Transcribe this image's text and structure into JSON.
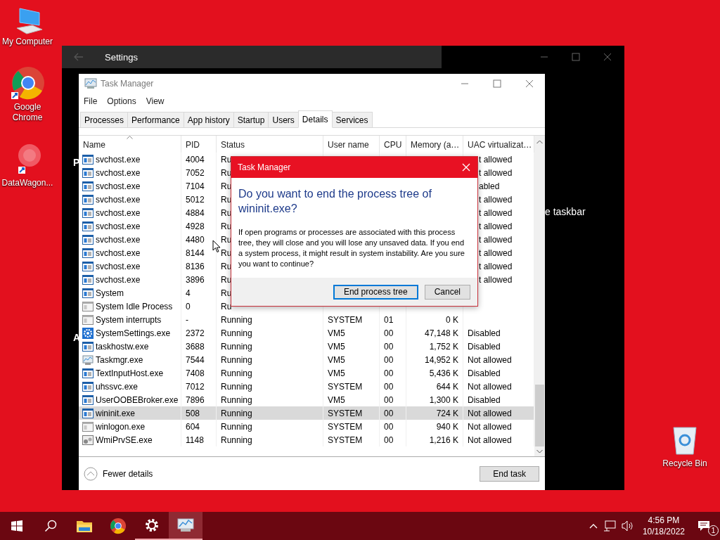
{
  "desktop": {
    "icons": [
      {
        "label": "My Computer",
        "kind": "computer"
      },
      {
        "label": "Google Chrome",
        "kind": "chrome"
      },
      {
        "label": "DataWagon...",
        "kind": "datawagon"
      }
    ],
    "recycle_bin": {
      "label": "Recycle Bin"
    }
  },
  "settings_window": {
    "title": "Settings",
    "side_letters": [
      "P",
      "A"
    ],
    "partial_text": "e taskbar"
  },
  "task_manager": {
    "title": "Task Manager",
    "menu": [
      "File",
      "Options",
      "View"
    ],
    "tabs": [
      {
        "label": "Processes",
        "selected": false
      },
      {
        "label": "Performance",
        "selected": false
      },
      {
        "label": "App history",
        "selected": false
      },
      {
        "label": "Startup",
        "selected": false
      },
      {
        "label": "Users",
        "selected": false
      },
      {
        "label": "Details",
        "selected": true
      },
      {
        "label": "Services",
        "selected": false
      }
    ],
    "columns": [
      {
        "label": "Name",
        "sorted": true
      },
      {
        "label": "PID"
      },
      {
        "label": "Status"
      },
      {
        "label": "User name"
      },
      {
        "label": "CPU"
      },
      {
        "label": "Memory (a…"
      },
      {
        "label": "UAC virtualizat…"
      }
    ],
    "rows": [
      {
        "kind": "app",
        "name": "svchost.exe",
        "pid": "4004",
        "status": "Ru",
        "uac": "t allowed",
        "selected": false
      },
      {
        "kind": "app",
        "name": "svchost.exe",
        "pid": "7052",
        "status": "Ru",
        "uac": "t allowed",
        "selected": false
      },
      {
        "kind": "app",
        "name": "svchost.exe",
        "pid": "7104",
        "status": "Ru",
        "uac": "abled",
        "selected": false
      },
      {
        "kind": "app",
        "name": "svchost.exe",
        "pid": "5012",
        "status": "Ru",
        "uac": "t allowed",
        "selected": false
      },
      {
        "kind": "app",
        "name": "svchost.exe",
        "pid": "4884",
        "status": "Ru",
        "uac": "t allowed",
        "selected": false
      },
      {
        "kind": "app",
        "name": "svchost.exe",
        "pid": "4928",
        "status": "Ru",
        "uac": "t allowed",
        "selected": false
      },
      {
        "kind": "app",
        "name": "svchost.exe",
        "pid": "4480",
        "status": "Ru",
        "uac": "t allowed",
        "selected": false
      },
      {
        "kind": "app",
        "name": "svchost.exe",
        "pid": "8144",
        "status": "Ru",
        "uac": "t allowed",
        "selected": false
      },
      {
        "kind": "app",
        "name": "svchost.exe",
        "pid": "8136",
        "status": "Ru",
        "uac": "t allowed",
        "selected": false
      },
      {
        "kind": "app",
        "name": "svchost.exe",
        "pid": "3896",
        "status": "Ru",
        "uac": "t allowed",
        "selected": false
      },
      {
        "kind": "app",
        "name": "System",
        "pid": "4",
        "status": "Ru",
        "selected": false
      },
      {
        "kind": "plain",
        "name": "System Idle Process",
        "pid": "0",
        "status": "Ru",
        "selected": false
      },
      {
        "kind": "plain",
        "name": "System interrupts",
        "pid": "-",
        "status": "Running",
        "user": "SYSTEM",
        "cpu": "01",
        "memory": "0 K",
        "selected": false
      },
      {
        "kind": "gear",
        "name": "SystemSettings.exe",
        "pid": "2372",
        "status": "Running",
        "user": "VM5",
        "cpu": "00",
        "memory": "47,148 K",
        "uac": "Disabled",
        "selected": false
      },
      {
        "kind": "app",
        "name": "taskhostw.exe",
        "pid": "3688",
        "status": "Running",
        "user": "VM5",
        "cpu": "00",
        "memory": "1,752 K",
        "uac": "Disabled",
        "selected": false
      },
      {
        "kind": "chart",
        "name": "Taskmgr.exe",
        "pid": "7544",
        "status": "Running",
        "user": "VM5",
        "cpu": "00",
        "memory": "14,952 K",
        "uac": "Not allowed",
        "selected": false
      },
      {
        "kind": "app",
        "name": "TextInputHost.exe",
        "pid": "7408",
        "status": "Running",
        "user": "VM5",
        "cpu": "00",
        "memory": "5,436 K",
        "uac": "Disabled",
        "selected": false
      },
      {
        "kind": "app",
        "name": "uhssvc.exe",
        "pid": "7012",
        "status": "Running",
        "user": "SYSTEM",
        "cpu": "00",
        "memory": "644 K",
        "uac": "Not allowed",
        "selected": false
      },
      {
        "kind": "app",
        "name": "UserOOBEBroker.exe",
        "pid": "7896",
        "status": "Running",
        "user": "VM5",
        "cpu": "00",
        "memory": "1,300 K",
        "uac": "Disabled",
        "selected": false
      },
      {
        "kind": "app",
        "name": "wininit.exe",
        "pid": "508",
        "status": "Running",
        "user": "SYSTEM",
        "cpu": "00",
        "memory": "724 K",
        "uac": "Not allowed",
        "selected": true
      },
      {
        "kind": "plain",
        "name": "winlogon.exe",
        "pid": "604",
        "status": "Running",
        "user": "SYSTEM",
        "cpu": "00",
        "memory": "940 K",
        "uac": "Not allowed",
        "selected": false
      },
      {
        "kind": "service",
        "name": "WmiPrvSE.exe",
        "pid": "1148",
        "status": "Running",
        "user": "SYSTEM",
        "cpu": "00",
        "memory": "1,216 K",
        "uac": "Not allowed",
        "selected": false
      }
    ],
    "fewer_details": "Fewer details",
    "end_task": "End task"
  },
  "dialog": {
    "title": "Task Manager",
    "heading": "Do you want to end the process tree of wininit.exe?",
    "body": "If open programs or processes are associated with this process tree, they will close and you will lose any unsaved data. If you end a system process, it might result in system instability. Are you sure you want to continue?",
    "buttons": [
      {
        "label": "End process tree",
        "default": true
      },
      {
        "label": "Cancel",
        "default": false
      }
    ]
  },
  "taskbar": {
    "apps": [
      {
        "kind": "folder",
        "active": false
      },
      {
        "kind": "chrome",
        "active": false
      },
      {
        "kind": "gear",
        "active": false,
        "running": true
      },
      {
        "kind": "taskmgr",
        "active": true,
        "running": true
      }
    ],
    "time": "4:56 PM",
    "date": "10/18/2022",
    "notifications": "1"
  }
}
